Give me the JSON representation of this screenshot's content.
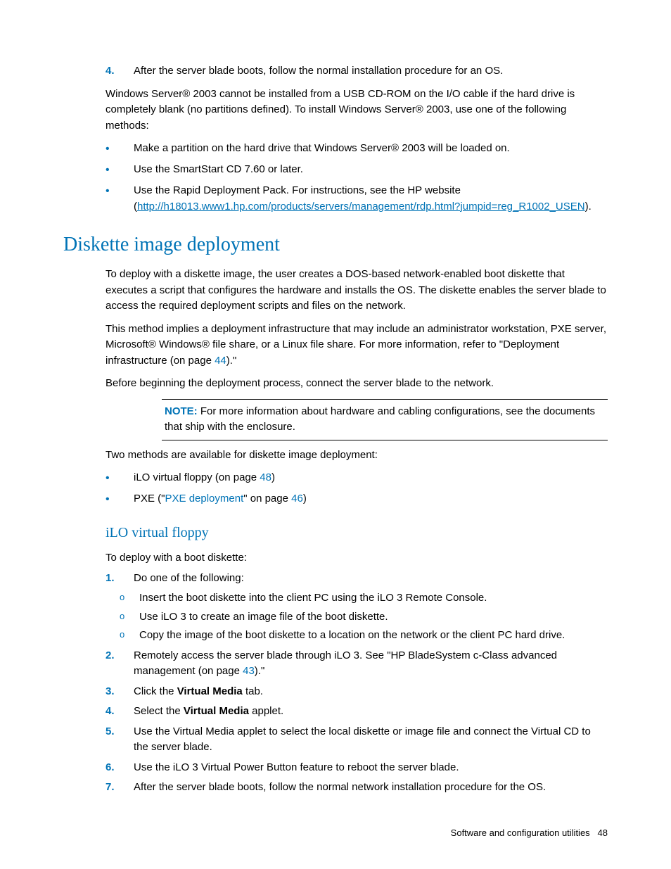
{
  "ordered_top": {
    "num4": "4.",
    "item4": "After the server blade boots, follow the normal installation procedure for an OS."
  },
  "para_ws2003": "Windows Server® 2003 cannot be installed from a USB CD-ROM on the I/O cable if the hard drive is completely blank (no partitions defined). To install Windows Server® 2003, use one of the following methods:",
  "bullets_top": {
    "b1": "Make a partition on the hard drive that Windows Server® 2003 will be loaded on.",
    "b2": "Use the SmartStart CD 7.60 or later.",
    "b3_pre": "Use the Rapid Deployment Pack. For instructions, see the HP website (",
    "b3_link": "http://h18013.www1.hp.com/products/servers/management/rdp.html?jumpid=reg_R1002_USEN",
    "b3_post": ")."
  },
  "heading_diskette": "Diskette image deployment",
  "para_diskette1": "To deploy with a diskette image, the user creates a DOS-based network-enabled boot diskette that executes a script that configures the hardware and installs the OS. The diskette enables the server blade to access the required deployment scripts and files on the network.",
  "para_diskette2_pre": "This method implies a deployment infrastructure that may include an administrator workstation, PXE server, Microsoft® Windows® file share, or a Linux file share. For more information, refer to \"Deployment infrastructure (on page ",
  "para_diskette2_link": "44",
  "para_diskette2_post": ").\"",
  "para_before": "Before beginning the deployment process, connect the server blade to the network.",
  "note_label": "NOTE:",
  "note_text": "  For more information about hardware and cabling configurations, see the documents that ship with the enclosure.",
  "para_two_methods": "Two methods are available for diskette image deployment:",
  "bullets_methods": {
    "m1_pre": "iLO virtual floppy (on page ",
    "m1_link": "48",
    "m1_post": ")",
    "m2_pre": "PXE (\"",
    "m2_link": "PXE deployment",
    "m2_post": "\" on page ",
    "m2_page": "46",
    "m2_end": ")"
  },
  "heading_ilo": "iLO virtual floppy",
  "para_ilo_intro": "To deploy with a boot diskette:",
  "ilo_steps": {
    "n1": "1.",
    "s1": "Do one of the following:",
    "s1a": "Insert the boot diskette into the client PC using the iLO 3 Remote Console.",
    "s1b": "Use iLO 3 to create an image file of the boot diskette.",
    "s1c": "Copy the image of the boot diskette to a location on the network or the client PC hard drive.",
    "n2": "2.",
    "s2_pre": "Remotely access the server blade through iLO 3. See \"HP BladeSystem c-Class advanced management (on page ",
    "s2_link": "43",
    "s2_post": ").\"",
    "n3": "3.",
    "s3_pre": "Click the ",
    "s3_bold": "Virtual Media",
    "s3_post": " tab.",
    "n4": "4.",
    "s4_pre": "Select the ",
    "s4_bold": "Virtual Media",
    "s4_post": " applet.",
    "n5": "5.",
    "s5": "Use the Virtual Media applet to select the local diskette or image file and connect the Virtual CD to the server blade.",
    "n6": "6.",
    "s6": "Use the iLO 3 Virtual Power Button feature to reboot the server blade.",
    "n7": "7.",
    "s7": "After the server blade boots, follow the normal network installation procedure for the OS."
  },
  "footer_text": "Software and configuration utilities",
  "footer_page": "48",
  "glyph_bullet": "•",
  "glyph_circle": "o"
}
